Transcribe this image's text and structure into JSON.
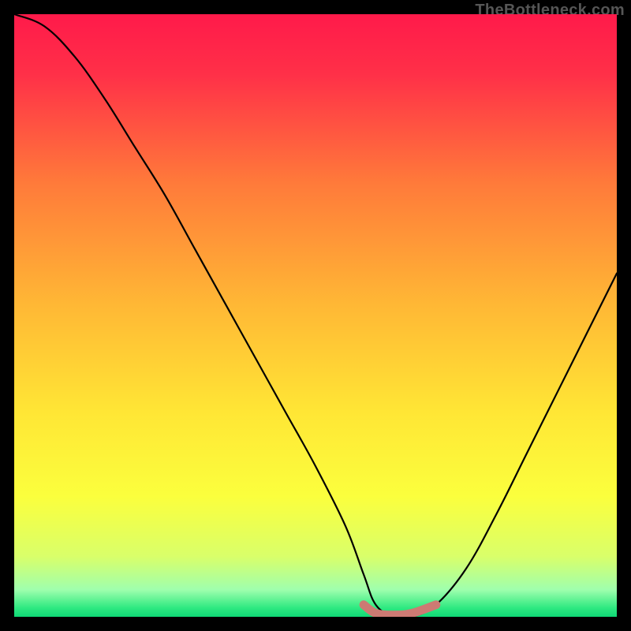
{
  "attribution": "TheBottleneck.com",
  "chart_data": {
    "type": "line",
    "title": "",
    "xlabel": "",
    "ylabel": "",
    "xlim": [
      0,
      100
    ],
    "ylim": [
      0,
      100
    ],
    "grid": false,
    "series": [
      {
        "name": "bottleneck-curve",
        "color": "#000000",
        "x": [
          0,
          5,
          10,
          15,
          20,
          25,
          30,
          35,
          40,
          45,
          50,
          55,
          58,
          60,
          63,
          66,
          70,
          75,
          80,
          85,
          90,
          95,
          100
        ],
        "y": [
          100,
          98,
          93,
          86,
          78,
          70,
          61,
          52,
          43,
          34,
          25,
          15,
          7,
          2,
          0,
          0,
          2,
          8,
          17,
          27,
          37,
          47,
          57
        ]
      },
      {
        "name": "optimal-range-marker",
        "color": "#cd7a73",
        "x": [
          58,
          60,
          63,
          66,
          70
        ],
        "y": [
          2,
          0.6,
          0.3,
          0.6,
          2
        ]
      }
    ],
    "background": {
      "type": "vertical-gradient",
      "stops": [
        {
          "pos": 0.0,
          "color": "#ff1a4a"
        },
        {
          "pos": 0.1,
          "color": "#ff3048"
        },
        {
          "pos": 0.28,
          "color": "#ff7a3a"
        },
        {
          "pos": 0.48,
          "color": "#ffb735"
        },
        {
          "pos": 0.66,
          "color": "#ffe635"
        },
        {
          "pos": 0.8,
          "color": "#fbff3d"
        },
        {
          "pos": 0.9,
          "color": "#d9ff6a"
        },
        {
          "pos": 0.955,
          "color": "#9fffad"
        },
        {
          "pos": 0.985,
          "color": "#2fe981"
        },
        {
          "pos": 1.0,
          "color": "#0fd876"
        }
      ]
    }
  }
}
